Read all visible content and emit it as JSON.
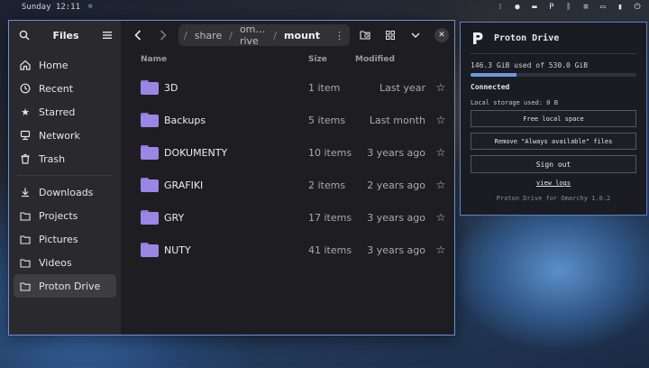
{
  "topbar": {
    "datetime": "Sunday 12:11",
    "weather_icon": "sun-icon",
    "tray_icons": [
      "grid-icon",
      "water-drop-icon",
      "car-icon",
      "proton-icon",
      "bluetooth-icon",
      "sliders-icon",
      "laptop-icon",
      "battery-icon",
      "power-icon"
    ]
  },
  "files": {
    "title": "Files",
    "sidebar": {
      "places": [
        {
          "label": "Home",
          "icon": "home-icon"
        },
        {
          "label": "Recent",
          "icon": "clock-icon"
        },
        {
          "label": "Starred",
          "icon": "star-icon"
        },
        {
          "label": "Network",
          "icon": "network-icon"
        },
        {
          "label": "Trash",
          "icon": "trash-icon"
        }
      ],
      "bookmarks": [
        {
          "label": "Downloads",
          "icon": "download-icon"
        },
        {
          "label": "Projects",
          "icon": "folder-icon"
        },
        {
          "label": "Pictures",
          "icon": "folder-icon"
        },
        {
          "label": "Videos",
          "icon": "folder-icon"
        },
        {
          "label": "Proton Drive",
          "icon": "folder-icon"
        }
      ]
    },
    "path": {
      "segments": [
        "share",
        "om… rive",
        "mount"
      ]
    },
    "columns": {
      "name": "Name",
      "size": "Size",
      "modified": "Modified"
    },
    "rows": [
      {
        "name": "3D",
        "size": "1 item",
        "modified": "Last year"
      },
      {
        "name": "Backups",
        "size": "5 items",
        "modified": "Last month"
      },
      {
        "name": "DOKUMENTY",
        "size": "10 items",
        "modified": "3 years ago"
      },
      {
        "name": "GRAFIKI",
        "size": "2 items",
        "modified": "2 years ago"
      },
      {
        "name": "GRY",
        "size": "17 items",
        "modified": "3 years ago"
      },
      {
        "name": "NUTY",
        "size": "41 items",
        "modified": "3 years ago"
      }
    ]
  },
  "proton": {
    "title": "Proton Drive",
    "usage": "146.3 GiB used of 530.0 GiB",
    "usage_fraction": 0.276,
    "status": "Connected",
    "local_storage": "Local storage used: 0 B",
    "btn_free": "Free local space",
    "btn_remove": "Remove \"Always available\" files",
    "btn_signout": "Sign out",
    "link_logs": "view logs",
    "version": "Proton Drive for Omarchy 1.0.2",
    "accent": "#6b9be0"
  }
}
